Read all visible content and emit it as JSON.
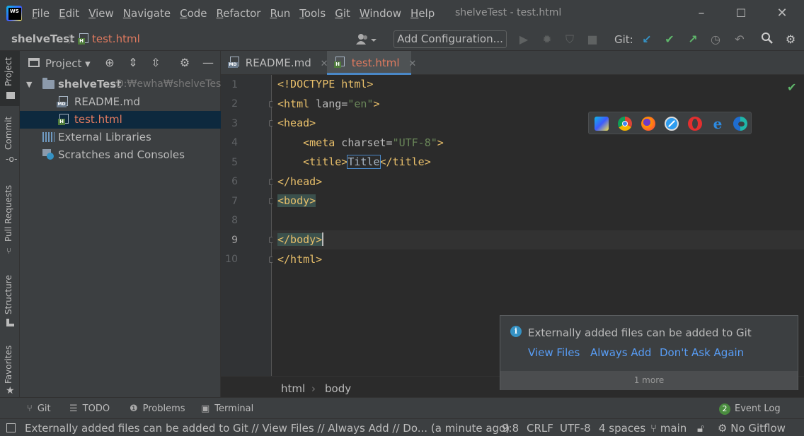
{
  "window": {
    "title": "shelveTest - test.html",
    "minimize": "–",
    "maximize": "☐",
    "close": "✕"
  },
  "menu": [
    "File",
    "Edit",
    "View",
    "Navigate",
    "Code",
    "Refactor",
    "Run",
    "Tools",
    "Git",
    "Window",
    "Help"
  ],
  "navbar": {
    "project": "shelveTest",
    "separator": "〉",
    "file": "test.html",
    "add_configuration": "Add Configuration...",
    "git_label": "Git:"
  },
  "left_strip": {
    "project": "Project",
    "commit": "Commit",
    "pull_requests": "Pull Requests",
    "structure": "Structure",
    "favorites": "Favorites"
  },
  "project_panel": {
    "header": "Project",
    "root_name": "shelveTest",
    "root_path": "D:₩ewha₩shelveTest",
    "files": [
      "README.md",
      "test.html"
    ],
    "external_libraries": "External Libraries",
    "scratches": "Scratches and Consoles"
  },
  "editor_tabs": [
    {
      "label": "README.md",
      "active": false
    },
    {
      "label": "test.html",
      "active": true
    }
  ],
  "editor": {
    "line_numbers": [
      "1",
      "2",
      "3",
      "4",
      "5",
      "6",
      "7",
      "8",
      "9",
      "10"
    ],
    "current_line": 9,
    "code": {
      "l1": "<!DOCTYPE html>",
      "l2_tag_open": "<html",
      "l2_attr": " lang=",
      "l2_val": "\"en\"",
      "l2_close": ">",
      "l3": "<head>",
      "l4_tag": "    <meta",
      "l4_attr": " charset=",
      "l4_val": "\"UTF-8\"",
      "l4_close": ">",
      "l5_open": "    <title>",
      "l5_text": "Title",
      "l5_close": "</title>",
      "l6": "</head>",
      "l7": "<body>",
      "l8": "",
      "l9": "</body>",
      "l10": "</html>"
    },
    "crumbs": [
      "html",
      "body"
    ]
  },
  "notification": {
    "text": "Externally added files can be added to Git",
    "links": [
      "View Files",
      "Always Add",
      "Don't Ask Again"
    ],
    "more": "1 more"
  },
  "bottom_tools": {
    "git": "Git",
    "todo": "TODO",
    "problems": "Problems",
    "terminal": "Terminal",
    "event_count": "2",
    "event_log": "Event Log"
  },
  "status": {
    "message": "Externally added files can be added to Git // View Files // Always Add // Do... (a minute ago)",
    "position": "9:8",
    "line_sep": "CRLF",
    "encoding": "UTF-8",
    "indent": "4 spaces",
    "branch": "main",
    "gitflow": "No Gitflow"
  },
  "colors": {
    "accent": "#4a88c7",
    "link": "#589df6",
    "active_file": "#e07a5f",
    "ok_green": "#5fb66b"
  }
}
